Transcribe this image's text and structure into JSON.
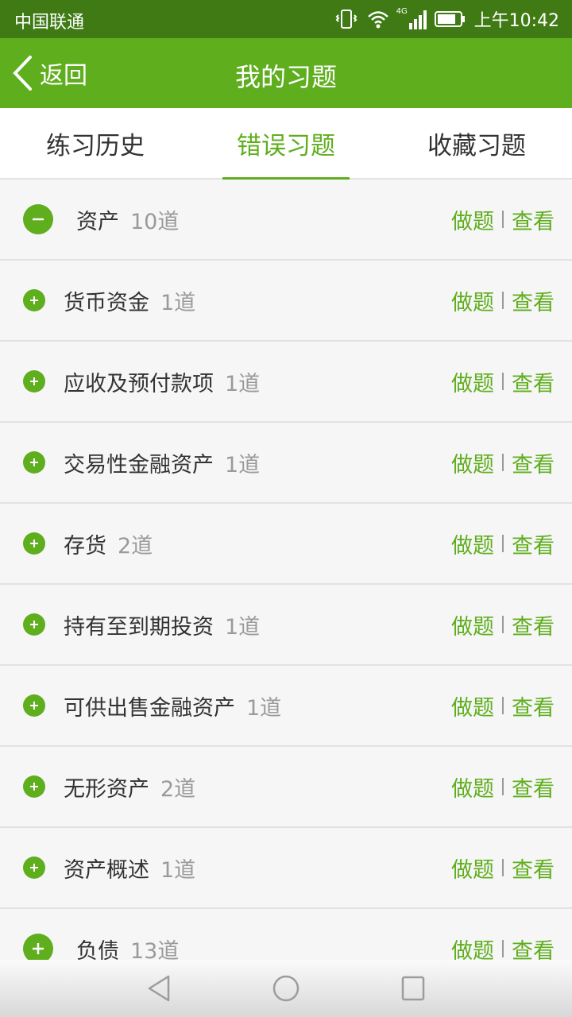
{
  "status_bar": {
    "carrier": "中国联通",
    "network": "4G",
    "time": "上午10:42",
    "icons": [
      "vibrate-icon",
      "wifi-icon",
      "signal-icon",
      "battery-icon"
    ]
  },
  "app_bar": {
    "back_label": "返回",
    "title": "我的习题"
  },
  "tabs": [
    {
      "label": "练习历史",
      "active": false
    },
    {
      "label": "错误习题",
      "active": true
    },
    {
      "label": "收藏习题",
      "active": false
    }
  ],
  "actions": {
    "do_label": "做题",
    "view_label": "查看"
  },
  "items": [
    {
      "name": "资产",
      "count": "10道",
      "level": 0,
      "state": "expanded"
    },
    {
      "name": "货币资金",
      "count": "1道",
      "level": 1,
      "state": "collapsed"
    },
    {
      "name": "应收及预付款项",
      "count": "1道",
      "level": 1,
      "state": "collapsed"
    },
    {
      "name": "交易性金融资产",
      "count": "1道",
      "level": 1,
      "state": "collapsed"
    },
    {
      "name": "存货",
      "count": "2道",
      "level": 1,
      "state": "collapsed"
    },
    {
      "name": "持有至到期投资",
      "count": "1道",
      "level": 1,
      "state": "collapsed"
    },
    {
      "name": "可供出售金融资产",
      "count": "1道",
      "level": 1,
      "state": "collapsed"
    },
    {
      "name": "无形资产",
      "count": "2道",
      "level": 1,
      "state": "collapsed"
    },
    {
      "name": "资产概述",
      "count": "1道",
      "level": 1,
      "state": "collapsed"
    },
    {
      "name": "负债",
      "count": "13道",
      "level": 0,
      "state": "collapsed"
    }
  ],
  "colors": {
    "accent": "#5fae1e",
    "status_bar": "#3f7a14",
    "text": "#333333",
    "muted": "#9a9a9a"
  }
}
